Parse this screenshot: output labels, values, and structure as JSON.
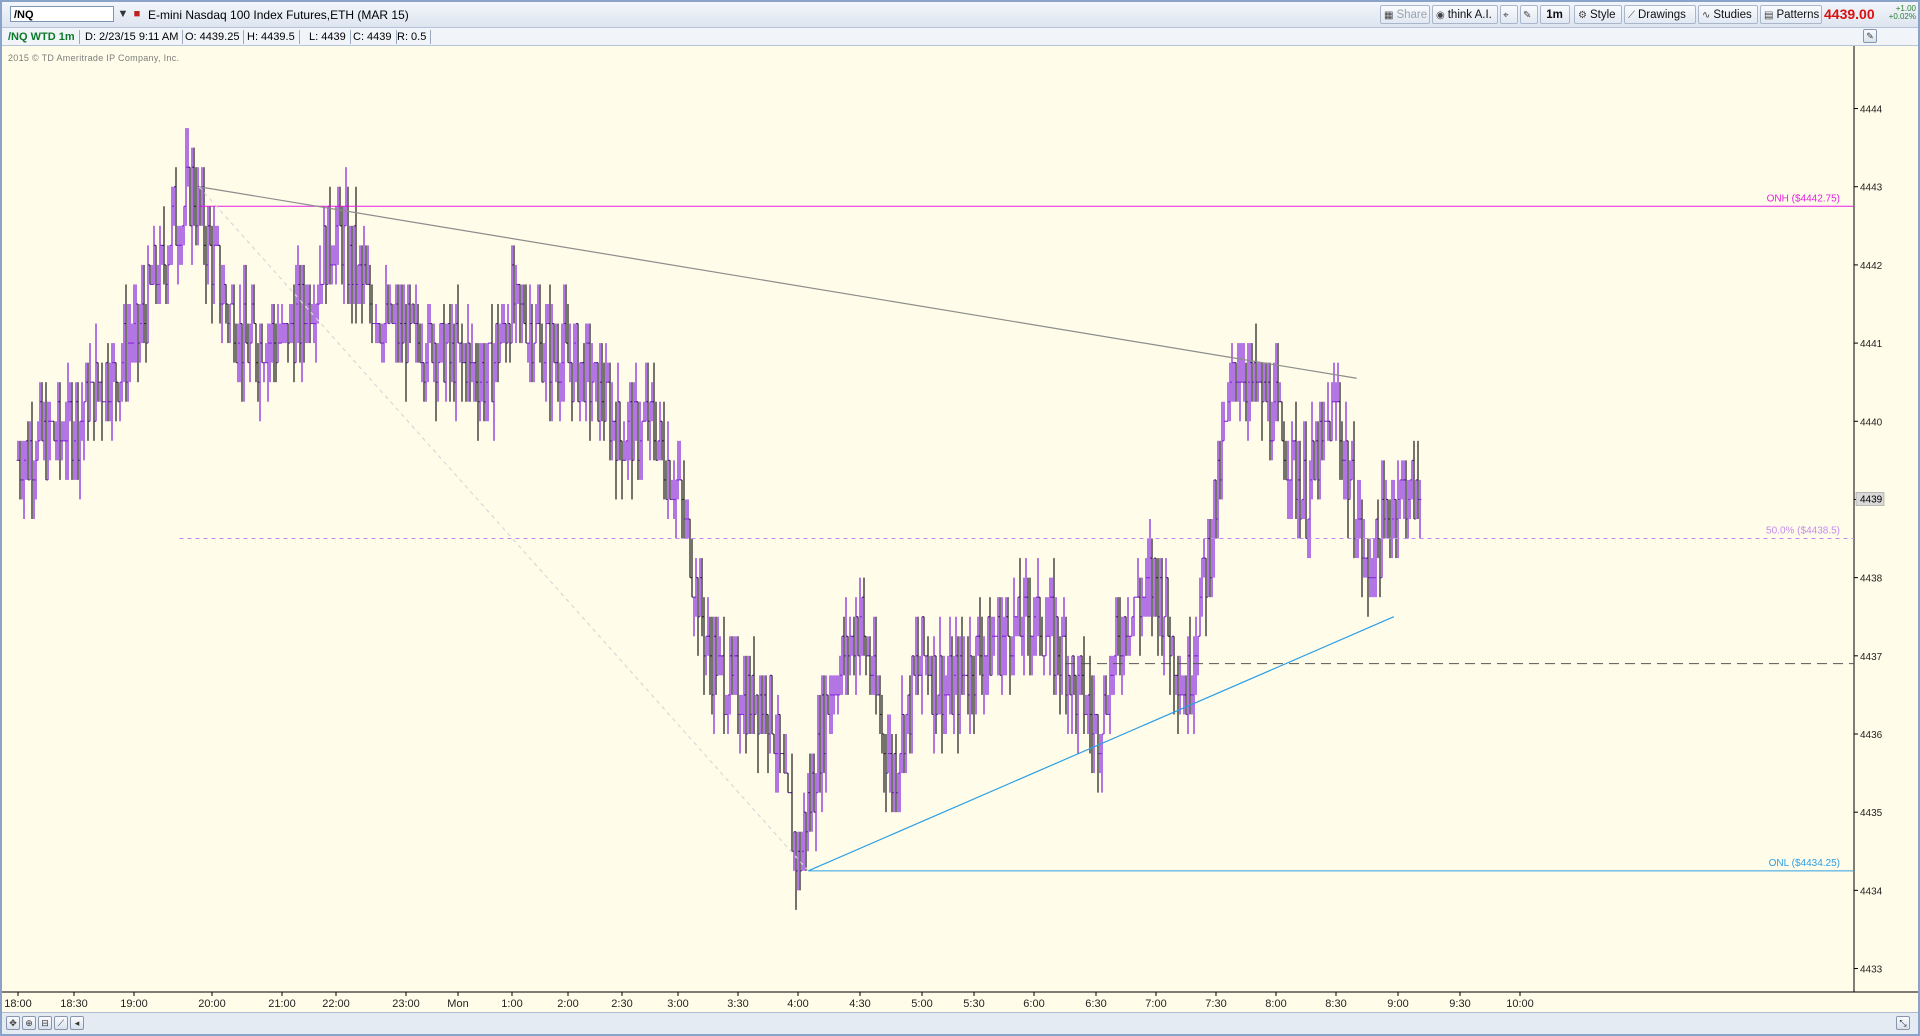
{
  "toolbar": {
    "symbol": "/NQ",
    "title": "E-mini Nasdaq 100 Index Futures,ETH (MAR 15)",
    "share_label": "Share",
    "think_label": "think A.I.",
    "timeframe_label": "1m",
    "style_label": "Style",
    "drawings_label": "Drawings",
    "studies_label": "Studies",
    "patterns_label": "Patterns",
    "last_price": "4439.00",
    "change_abs": "+1.00",
    "change_pct": "+0.02%"
  },
  "infobar": {
    "study_label": "/NQ WTD 1m",
    "date": "D: 2/23/15 9:11 AM",
    "open": "O: 4439.25",
    "high": "H: 4439.5",
    "low": "L: 4439",
    "close": "C: 4439",
    "range": "R: 0.5"
  },
  "chart_meta": {
    "copyright": "2015 © TD Ameritrade IP Company, Inc."
  },
  "colors": {
    "background": "#fffde9",
    "bar_up": "#8a2be2",
    "bar_down": "#2a2a2a",
    "onh_line": "#e41ee4",
    "onl_line": "#2d9fe6",
    "fib50_line": "#c58af0",
    "downtrend_line": "#8c8c8c",
    "uptrend_line": "#2d9fe6",
    "price_text": "#d81010"
  },
  "chart_data": {
    "type": "ohlc",
    "interval": "1 minute",
    "x_tick_labels": [
      "18:00",
      "18:30",
      "19:00",
      "20:00",
      "21:00",
      "22:00",
      "23:00",
      "Mon",
      "1:00",
      "2:00",
      "2:30",
      "3:00",
      "3:30",
      "4:00",
      "4:30",
      "5:00",
      "5:30",
      "6:00",
      "6:30",
      "7:00",
      "7:30",
      "8:00",
      "8:30",
      "9:00",
      "9:30",
      "10:00"
    ],
    "y_tick_labels": [
      4433,
      4434,
      4435,
      4436,
      4437,
      4438,
      4439,
      4440,
      4441,
      4442,
      4443,
      4444
    ],
    "ylim": [
      4432.7,
      4444.8
    ],
    "key_points": [
      {
        "time": "18:00",
        "price": 4439.5
      },
      {
        "time": "18:30",
        "price": 4440.0
      },
      {
        "time": "19:00",
        "price": 4441.0
      },
      {
        "time": "19:30",
        "price": 4442.5
      },
      {
        "time": "19:45",
        "price": 4443.0
      },
      {
        "time": "20:00",
        "price": 4442.0
      },
      {
        "time": "20:30",
        "price": 4441.0
      },
      {
        "time": "21:00",
        "price": 4441.0
      },
      {
        "time": "21:30",
        "price": 4441.5
      },
      {
        "time": "22:00",
        "price": 4442.5
      },
      {
        "time": "22:30",
        "price": 4441.5
      },
      {
        "time": "23:00",
        "price": 4441.0
      },
      {
        "time": "23:30",
        "price": 4441.0
      },
      {
        "time": "Mon",
        "price": 4440.8
      },
      {
        "time": "0:30",
        "price": 4440.5
      },
      {
        "time": "1:00",
        "price": 4441.5
      },
      {
        "time": "1:30",
        "price": 4441.0
      },
      {
        "time": "2:00",
        "price": 4440.8
      },
      {
        "time": "2:15",
        "price": 4440.5
      },
      {
        "time": "2:30",
        "price": 4439.8
      },
      {
        "time": "2:45",
        "price": 4440.0
      },
      {
        "time": "3:00",
        "price": 4439.2
      },
      {
        "time": "3:15",
        "price": 4437.0
      },
      {
        "time": "3:30",
        "price": 4436.5
      },
      {
        "time": "3:45",
        "price": 4436.5
      },
      {
        "time": "4:00",
        "price": 4434.3
      },
      {
        "time": "4:15",
        "price": 4436.5
      },
      {
        "time": "4:30",
        "price": 4437.5
      },
      {
        "time": "4:45",
        "price": 4435.5
      },
      {
        "time": "5:00",
        "price": 4437.0
      },
      {
        "time": "5:15",
        "price": 4436.5
      },
      {
        "time": "5:30",
        "price": 4437.0
      },
      {
        "time": "6:00",
        "price": 4437.5
      },
      {
        "time": "6:15",
        "price": 4437.0
      },
      {
        "time": "6:30",
        "price": 4436.0
      },
      {
        "time": "6:45",
        "price": 4437.5
      },
      {
        "time": "7:00",
        "price": 4438.0
      },
      {
        "time": "7:15",
        "price": 4436.5
      },
      {
        "time": "7:30",
        "price": 4439.0
      },
      {
        "time": "7:40",
        "price": 4440.8
      },
      {
        "time": "8:00",
        "price": 4440.0
      },
      {
        "time": "8:15",
        "price": 4439.0
      },
      {
        "time": "8:30",
        "price": 4440.2
      },
      {
        "time": "8:45",
        "price": 4438.0
      },
      {
        "time": "9:00",
        "price": 4439.2
      },
      {
        "time": "9:11",
        "price": 4439.0
      }
    ],
    "levels": [
      {
        "label": "ONH ($4442.75)",
        "price": 4442.75,
        "from_time": "19:50"
      },
      {
        "label": "ONL ($4434.25)",
        "price": 4434.25,
        "from_time": "4:05"
      },
      {
        "label": "50.0%  ($4438.5)",
        "price": 4438.5,
        "from_time": "19:35"
      },
      {
        "label": "",
        "price": 4436.9,
        "from_time": "6:15"
      }
    ],
    "trendlines": [
      {
        "name": "downtrend",
        "from": {
          "time": "19:50",
          "price": 4443.0
        },
        "to": {
          "time": "8:40",
          "price": 4440.55
        }
      },
      {
        "name": "uptrend",
        "from": {
          "time": "4:05",
          "price": 4434.25
        },
        "to": {
          "time": "8:58",
          "price": 4437.5
        }
      },
      {
        "name": "retracement",
        "from": {
          "time": "19:50",
          "price": 4443.0
        },
        "to": {
          "time": "4:05",
          "price": 4434.25
        }
      }
    ],
    "last_price_label": "4439",
    "grid": false,
    "legend": "none"
  }
}
